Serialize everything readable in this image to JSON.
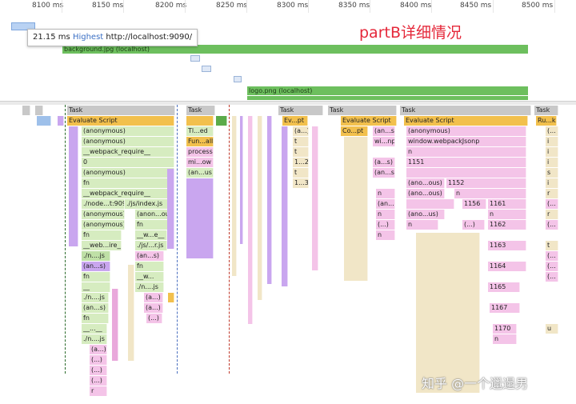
{
  "ruler": {
    "ticks": [
      "8100 ms",
      "8150 ms",
      "8200 ms",
      "8250 ms",
      "8300 ms",
      "8350 ms",
      "8400 ms",
      "8450 ms",
      "8500 ms"
    ]
  },
  "tooltip": {
    "duration": "21.15 ms",
    "priority": "Highest",
    "url": "http://localhost:9090/"
  },
  "network": {
    "bars": [
      "background.jpg (localhost)",
      "logo.png (localhost)"
    ]
  },
  "annotation": "partB详细情况",
  "watermark": "知乎 @一个邋遢男",
  "flame": {
    "task_label": "Task",
    "tasks": [
      "Task",
      "Task",
      "Task",
      "Task",
      "Task",
      "Task"
    ],
    "main_col": [
      "Evaluate Script",
      "(anonymous)",
      "(anonymous)",
      "__webpack_require__",
      "0",
      "(anonymous)",
      "fn",
      "__webpack_require__",
      "./node...t:9090",
      "(anonymous)",
      "(anonymous)",
      "fn",
      "__web...ire__",
      "./n....js",
      "(an...s)",
      "fn",
      "__",
      "./n....js",
      "(an...s)",
      "fn",
      "__...__",
      "./n....js",
      "(a...)",
      "(...)",
      "(...)",
      "(...)",
      "r"
    ],
    "col2": [
      "./js/index.js",
      "(anon...ous)",
      "fn",
      "__w...e__",
      "./js/...r.js",
      "(an...s)",
      "fn",
      "__w...",
      "./n....js",
      "(a...)",
      "(a...)",
      "(...)"
    ],
    "t2": [
      "Tl...ed",
      "Fun...all",
      "process",
      "mi...ow",
      "(an...us)"
    ],
    "ev2": "Ev...pt",
    "t3": [
      "(a...)",
      "t",
      "t",
      "1...2",
      "t",
      "1...3"
    ],
    "ev3": "Evaluate Script",
    "co": "Co...pt",
    "t4": [
      "(an...s)",
      "wi...np",
      "(a...s)",
      "(an...s)",
      "n",
      "(an...s)",
      "n",
      "(...)",
      "n"
    ],
    "ev4": "Evaluate Script",
    "t5": [
      "(anonymous)",
      "window.webpackJsonp",
      "n",
      "1151",
      "(ano...ous)",
      "(ano...ous)",
      "(ano...us)",
      "n"
    ],
    "t5b": [
      "1152",
      "n",
      "1156",
      "1161",
      "n",
      "(...)",
      "1162",
      "1163",
      "1164",
      "1165",
      "1167",
      "1170",
      "n"
    ],
    "ru": [
      "Ru...ks",
      "(...",
      "i",
      "i",
      "i",
      "s",
      "i",
      "r",
      "(...",
      "r",
      "(...",
      "t",
      "(...",
      "(...",
      "(...",
      "u"
    ]
  }
}
